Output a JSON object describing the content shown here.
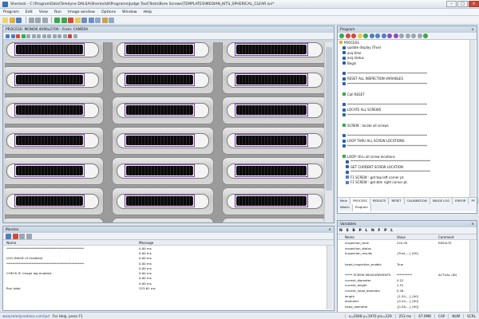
{
  "app": {
    "title": "Sherlock - C:\\ProgramData\\Teledyne DALSA\\Sherlock8\\Programs\\Judge Tool\\Tests\\Bore Screws\\TEMPLATES\\MEDIAN_KITS_SPHERICAL_CLEAR.ivs*"
  },
  "menu": [
    "Program",
    "Edit",
    "View",
    "Run",
    "Image window",
    "Options",
    "Window",
    "Help"
  ],
  "process_window": {
    "title": "PROCESS: MONO8 4096x2700 - From: CAMERA"
  },
  "program": {
    "title": "Program",
    "lines": [
      {
        "indent": 0,
        "icon": "folder",
        "text": "PROCESS"
      },
      {
        "indent": 1,
        "icon": "dot",
        "text": "update display (True)"
      },
      {
        "indent": 1,
        "icon": "dot",
        "text": "acq time"
      },
      {
        "indent": 1,
        "icon": "dot",
        "text": "acq status"
      },
      {
        "indent": 1,
        "icon": "dot",
        "text": "Begin"
      },
      {
        "indent": 1,
        "icon": "none",
        "text": ""
      },
      {
        "indent": 1,
        "icon": "dot",
        "text": "**************************************************"
      },
      {
        "indent": 1,
        "icon": "dot",
        "text": "RESET ALL INSPECTION VARIABLES"
      },
      {
        "indent": 1,
        "icon": "dot",
        "text": "**************************************************"
      },
      {
        "indent": 1,
        "icon": "none",
        "text": ""
      },
      {
        "indent": 1,
        "icon": "green",
        "text": "Call RESET"
      },
      {
        "indent": 1,
        "icon": "none",
        "text": ""
      },
      {
        "indent": 1,
        "icon": "dot",
        "text": "**************************************************"
      },
      {
        "indent": 1,
        "icon": "dot",
        "text": "LOCATE ALL SCREWS"
      },
      {
        "indent": 1,
        "icon": "dot",
        "text": "**************************************************"
      },
      {
        "indent": 1,
        "icon": "none",
        "text": ""
      },
      {
        "indent": 1,
        "icon": "green",
        "text": "SCREW : locate all screws"
      },
      {
        "indent": 1,
        "icon": "none",
        "text": ""
      },
      {
        "indent": 1,
        "icon": "dot",
        "text": "**************************************************"
      },
      {
        "indent": 1,
        "icon": "dot",
        "text": "LOOP THRU ALL SCREW LOCATIONS"
      },
      {
        "indent": 1,
        "icon": "dot",
        "text": "**************************************************"
      },
      {
        "indent": 1,
        "icon": "none",
        "text": ""
      },
      {
        "indent": 1,
        "icon": "loop",
        "text": "LOOP: thru all screw locations"
      },
      {
        "indent": 2,
        "icon": "dot",
        "text": "**************************************************"
      },
      {
        "indent": 2,
        "icon": "dot",
        "text": "GET CURRENT SCREW LOCATION"
      },
      {
        "indent": 2,
        "icon": "dot",
        "text": "**************************************************"
      },
      {
        "indent": 2,
        "icon": "blue",
        "text": "F1  SCREW : get top left corner pt."
      },
      {
        "indent": 2,
        "icon": "blue",
        "text": "F1  SCREW : get btm right corner pt."
      },
      {
        "indent": 2,
        "icon": "none",
        "text": ""
      }
    ],
    "tabs_row1": [
      "Main",
      "PROCESS",
      "RESULTS",
      "RESET",
      "CALIBRATION",
      "IMAGE LOG",
      "ERROR",
      "PF"
    ],
    "tabs_row2": [
      "Watch",
      "Program"
    ]
  },
  "variables": {
    "title": "Variables",
    "toolbar_text": "N S B P L N F P L",
    "columns": [
      "Name",
      "Value",
      "Comment"
    ],
    "rows": [
      {
        "name": "inspection_time",
        "value": "220.05",
        "comment": "RESULTS"
      },
      {
        "name": "inspection_status",
        "value": "",
        "comment": ""
      },
      {
        "name": "inspection_results",
        "value": "{True,...} [90]",
        "comment": ""
      },
      {
        "name": "",
        "value": "",
        "comment": ""
      },
      {
        "name": "head_inspection_enable",
        "value": "True",
        "comment": ""
      },
      {
        "name": "",
        "value": "",
        "comment": ""
      },
      {
        "name": "*****  SCREW MEASUREMENTS",
        "value": "**********",
        "comment": "ACTUAL (IN)"
      },
      {
        "name": "current_diameter",
        "value": "0.22",
        "comment": ""
      },
      {
        "name": "current_length",
        "value": "1.51",
        "comment": ""
      },
      {
        "name": "current_head_diameter",
        "value": "0.28",
        "comment": ""
      },
      {
        "name": "length",
        "value": "{1.50,...} [90]",
        "comment": ""
      },
      {
        "name": "diameter",
        "value": "{0.20,...} [90]",
        "comment": ""
      },
      {
        "name": "head_diameter",
        "value": "{0.28,...} [90]",
        "comment": ""
      }
    ]
  },
  "monitor": {
    "title": "Monitor",
    "columns": [
      "Name",
      "Message"
    ],
    "rows": [
      {
        "name": "**************************************************",
        "msg": "0.00 ms"
      },
      {
        "name": "",
        "msg": "0.00 ms"
      },
      {
        "name": "LOG IMAGE (if enabled)",
        "msg": "0.00 ms"
      },
      {
        "name": "**************************************************",
        "msg": "0.00 ms"
      },
      {
        "name": "",
        "msg": "0.00 ms"
      },
      {
        "name": "CHECK IF: image log enabled",
        "msg": "0.00 ms"
      },
      {
        "name": "",
        "msg": "0.00 ms"
      },
      {
        "name": "",
        "msg": "0.00 ms"
      },
      {
        "name": "Run total",
        "msg": "253.61 ms"
      }
    ]
  },
  "status": {
    "help": "For Help, press F1",
    "link": "www.teledynedalsa.com/ipd",
    "coords": "x=2048 y=1970  pix=229",
    "time": "253 ms",
    "mem": "67.0MB",
    "cap": "CAP",
    "num": "NUM",
    "scrl": "SCRL"
  },
  "colors": {
    "accent": "#3a6fb0",
    "roi": "#7b3ba8",
    "roi_label": "#b8e02b"
  }
}
